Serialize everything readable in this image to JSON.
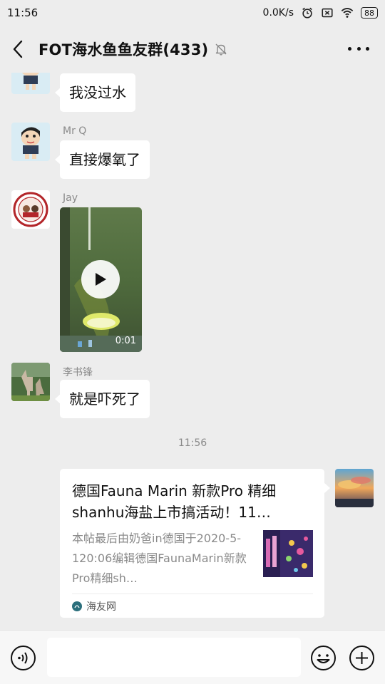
{
  "status": {
    "time": "11:56",
    "network_speed": "0.0K/s",
    "battery": "88",
    "icons": [
      "alarm-icon",
      "sim-icon",
      "wifi-icon",
      "battery-icon"
    ]
  },
  "header": {
    "title": "FOT海水鱼鱼友群(433)",
    "icons": [
      "back-icon",
      "mute-icon",
      "more-icon"
    ]
  },
  "messages": [
    {
      "type": "text",
      "sender": "",
      "text": "我没过水"
    },
    {
      "type": "text",
      "sender": "Mr Q",
      "text": "直接爆氧了"
    },
    {
      "type": "video",
      "sender": "Jay",
      "duration": "0:01"
    },
    {
      "type": "text",
      "sender": "李书锋",
      "text": "就是吓死了"
    }
  ],
  "timestamp": "11:56",
  "link_card": {
    "title": "德国Fauna Marin 新款Pro 精细shanhu海盐上市搞活动！11…",
    "desc": "本帖最后由奶爸in德国于2020-5-120:06编辑德国FaunaMarin新款Pro精细sh…",
    "source": "海友网"
  },
  "input": {
    "placeholder": "",
    "icons": [
      "voice-icon",
      "emoji-icon",
      "plus-icon"
    ]
  },
  "colors": {
    "background": "#ededed",
    "bubble": "#ffffff",
    "muted_text": "#8a8a8a"
  }
}
